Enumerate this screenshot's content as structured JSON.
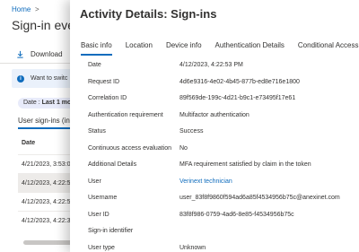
{
  "background": {
    "breadcrumb": {
      "home": "Home",
      "separator": ">"
    },
    "title": "Sign-in eve",
    "download_label": "Download",
    "banner_text": "Want to switc",
    "filter": {
      "prefix": "Date : ",
      "value": "Last 1 mo"
    },
    "section_tab": "User sign-ins (int",
    "table": {
      "column": "Date",
      "rows": [
        "4/21/2023, 3:53:0",
        "4/12/2023, 4:22:5",
        "4/12/2023, 4:22:5",
        "4/12/2023, 4:22:3"
      ],
      "selected_index": 1
    }
  },
  "panel": {
    "title": "Activity Details: Sign-ins",
    "tabs": [
      {
        "label": "Basic info",
        "active": true
      },
      {
        "label": "Location",
        "active": false
      },
      {
        "label": "Device info",
        "active": false
      },
      {
        "label": "Authentication Details",
        "active": false
      },
      {
        "label": "Conditional Access",
        "active": false
      }
    ],
    "details": [
      {
        "label": "Date",
        "value": "4/12/2023, 4:22:53 PM"
      },
      {
        "label": "Request ID",
        "value": "4d6e9316-4e02-4b45-877b-ed8e716e1800"
      },
      {
        "label": "Correlation ID",
        "value": "89f569de-199c-4d21-b9c1-e73495f17e61"
      },
      {
        "label": "Authentication requirement",
        "value": "Multifactor authentication"
      },
      {
        "label": "Status",
        "value": "Success"
      },
      {
        "label": "Continuous access evaluation",
        "value": "No"
      },
      {
        "label": "Additional Details",
        "value": "MFA requirement satisfied by claim in the token"
      },
      {
        "label": "User",
        "value": "Verinext technician",
        "link": true
      },
      {
        "label": "Username",
        "value": "user_83f8f9860f594ad6a85f4534956b75c@anexinet.com"
      },
      {
        "label": "User ID",
        "value": "83f8f986-0759-4ad6-8e85-f4534956b75c"
      },
      {
        "label": "Sign-in identifier",
        "value": ""
      },
      {
        "label": "User type",
        "value": "Unknown"
      }
    ]
  },
  "colors": {
    "accent": "#0f6cbd",
    "selected_row": "#edebe9",
    "banner": "#eaf1fb"
  },
  "icons": [
    "download-icon",
    "info-icon"
  ]
}
